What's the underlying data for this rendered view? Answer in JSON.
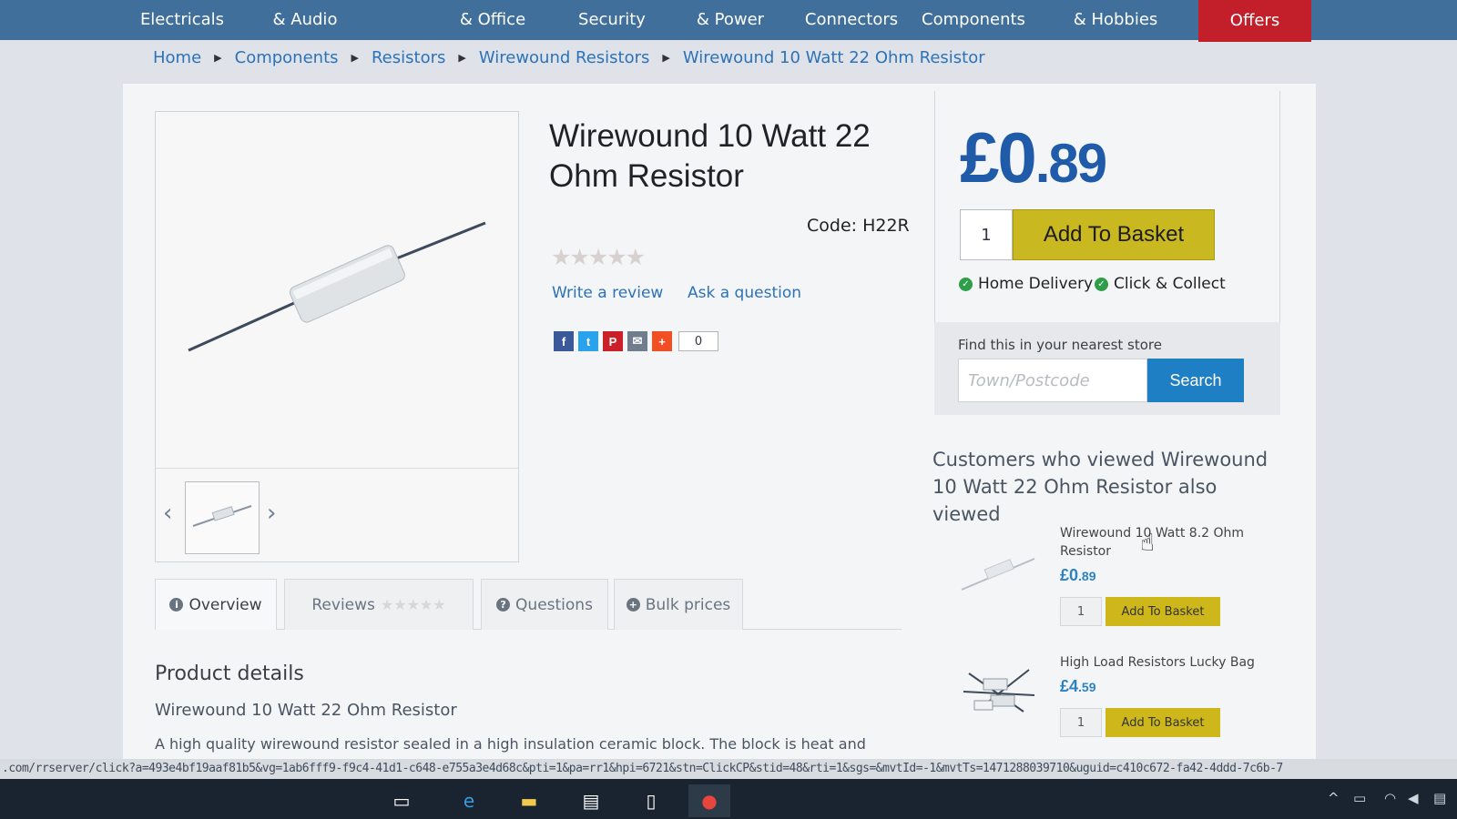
{
  "nav": {
    "items": [
      {
        "label": "Electricals"
      },
      {
        "label": "& Audio"
      },
      {
        "label": "& Office"
      },
      {
        "label": "Security"
      },
      {
        "label": "& Power"
      },
      {
        "label": "Connectors"
      },
      {
        "label": "Components"
      },
      {
        "label": "& Hobbies"
      }
    ],
    "offer_label": "Offers",
    "offer_color": "#c21f2b"
  },
  "breadcrumb": [
    "Home",
    "Components",
    "Resistors",
    "Wirewound Resistors",
    "Wirewound 10 Watt 22 Ohm Resistor"
  ],
  "product": {
    "title": "Wirewound 10 Watt 22 Ohm Resistor",
    "code": "Code: H22R",
    "rating_stars": "★★★★★",
    "write_review": "Write a review",
    "ask_question": "Ask a question",
    "share_count": "0",
    "price_main": "£0",
    "price_pence": ".89",
    "qty": "1",
    "add_label": "Add To Basket",
    "home_delivery": "Home Delivery",
    "click_collect": "Click & Collect"
  },
  "store": {
    "label": "Find this in your nearest store",
    "placeholder": "Town/Postcode",
    "button": "Search"
  },
  "also_viewed": {
    "title": "Customers who viewed Wirewound 10 Watt 22 Ohm Resistor also viewed",
    "items": [
      {
        "name": "Wirewound 10 Watt 8.2 Ohm Resistor",
        "price_main": "£0",
        "price_pence": ".89",
        "qty": "1",
        "add_label": "Add To Basket"
      },
      {
        "name": "High Load Resistors Lucky Bag",
        "price_main": "£4",
        "price_pence": ".59",
        "qty": "1",
        "add_label": "Add To Basket"
      }
    ]
  },
  "tabs": [
    {
      "label": "Overview",
      "icon": "info-icon"
    },
    {
      "label": "Reviews",
      "icon": "star-icon"
    },
    {
      "label": "Questions",
      "icon": "question-icon"
    },
    {
      "label": "Bulk prices",
      "icon": "plus-icon"
    }
  ],
  "details": {
    "heading": "Product details",
    "name": "Wirewound 10 Watt 22 Ohm Resistor",
    "description": "A high quality wirewound resistor sealed in a high insulation ceramic block. The block is heat and"
  },
  "statusbar": {
    "url": ".com/rrserver/click?a=493e4bf19aaf81b5&vg=1ab6fff9-f9c4-41d1-c648-e755a3e4d68c&pti=1&pa=rr1&hpi=6721&stn=ClickCP&stid=48&rti=1&sgs=&mvtId=-1&mvtTs=1471288039710&uguid=c410c672-fa42-4ddd-7c6b-7"
  },
  "colors": {
    "accent": "#1f5ba8",
    "basket": "#c9b81f",
    "search": "#1f7fc4",
    "nav": "#3f6f9a",
    "check": "#2e9e4a"
  }
}
